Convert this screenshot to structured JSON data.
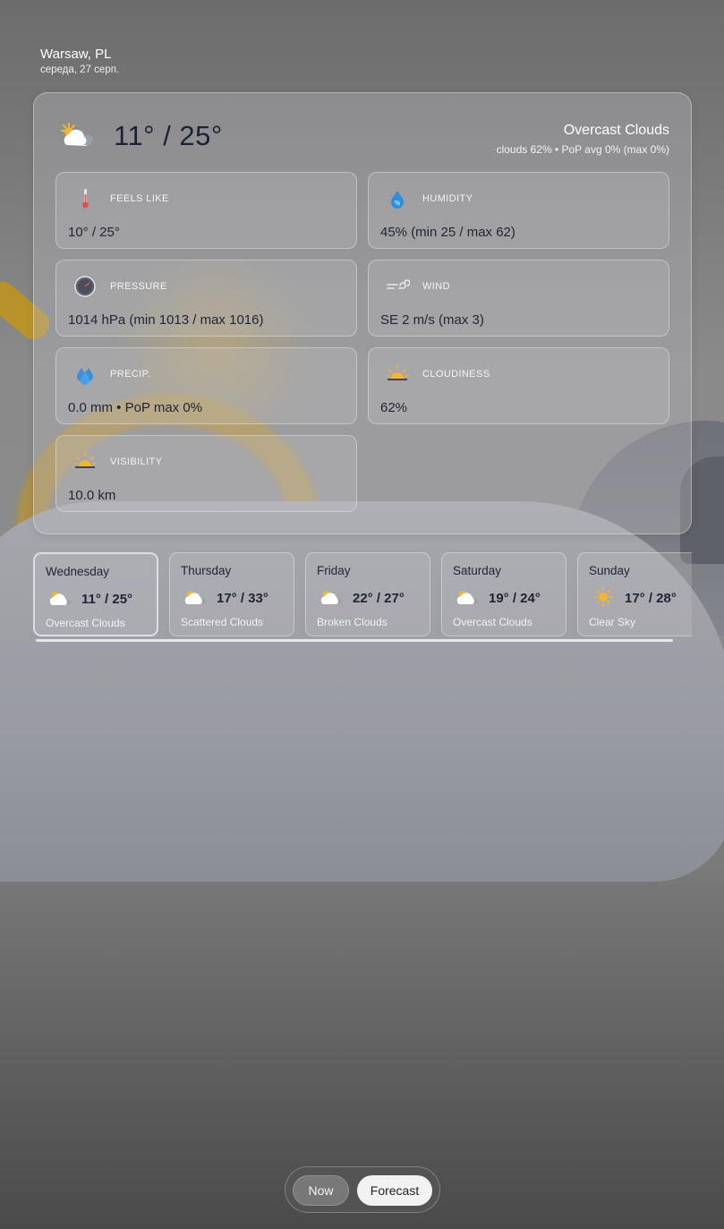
{
  "header": {
    "city": "Warsaw, PL",
    "date": "середа, 27 серп."
  },
  "current": {
    "icon": "partly-cloudy-icon",
    "temps": "11° / 25°",
    "condition": "Overcast Clouds",
    "subline": "clouds 62% • PoP avg 0% (max 0%)"
  },
  "metrics": [
    {
      "label": "FEELS LIKE",
      "value": "10° / 25°",
      "icon": "thermometer-icon"
    },
    {
      "label": "HUMIDITY",
      "value": "45% (min 25 / max 62)",
      "icon": "humidity-drop-icon"
    },
    {
      "label": "PRESSURE",
      "value": "1014 hPa (min 1013 / max 1016)",
      "icon": "barometer-icon"
    },
    {
      "label": "WIND",
      "value": "SE 2 m/s (max 3)",
      "icon": "wind-icon"
    },
    {
      "label": "PRECIP.",
      "value": "0.0 mm • PoP max 0%",
      "icon": "raindrops-icon"
    },
    {
      "label": "CLOUDINESS",
      "value": "62%",
      "icon": "sunrise-icon"
    },
    {
      "label": "VISIBILITY",
      "value": "10.0 km",
      "icon": "sunrise-icon"
    }
  ],
  "days": [
    {
      "name": "Wednesday",
      "temps": "11° / 25°",
      "desc": "Overcast Clouds",
      "icon": "partly-cloudy-icon"
    },
    {
      "name": "Thursday",
      "temps": "17° / 33°",
      "desc": "Scattered Clouds",
      "icon": "partly-cloudy-icon"
    },
    {
      "name": "Friday",
      "temps": "22° / 27°",
      "desc": "Broken Clouds",
      "icon": "partly-cloudy-icon"
    },
    {
      "name": "Saturday",
      "temps": "19° / 24°",
      "desc": "Overcast Clouds",
      "icon": "partly-cloudy-icon"
    },
    {
      "name": "Sunday",
      "temps": "17° / 28°",
      "desc": "Clear Sky",
      "icon": "sun-icon"
    }
  ],
  "toggle": {
    "now": "Now",
    "forecast": "Forecast"
  },
  "colors": {
    "text_dark": "#1f2533",
    "sun": "#f3b532",
    "active_toggle": "#f2f2f2"
  }
}
